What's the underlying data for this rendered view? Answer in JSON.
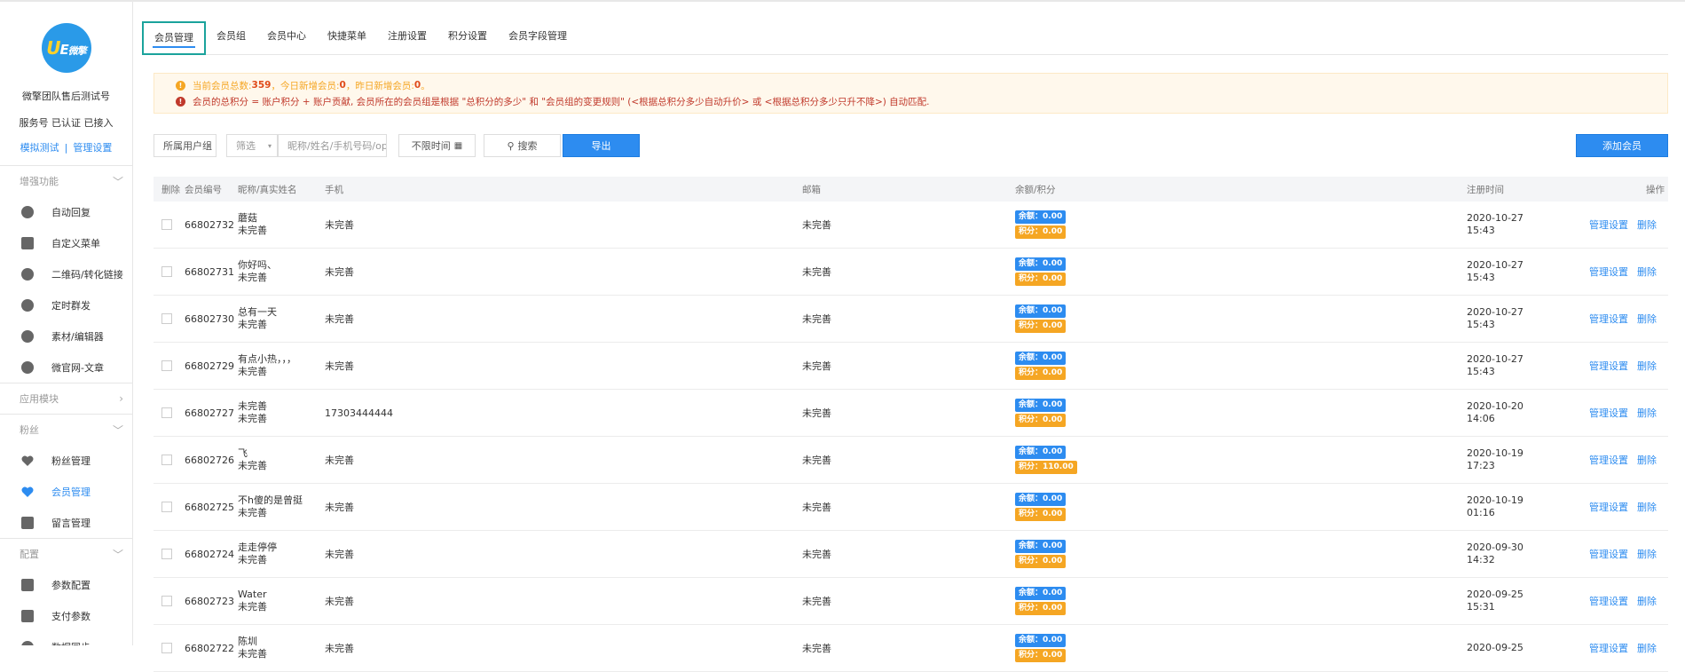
{
  "sidebar": {
    "account_name": "微擎团队售后测试号",
    "account_status": "服务号 已认证 已接入",
    "link_test": "模拟测试",
    "link_sep": "|",
    "link_manage": "管理设置",
    "sections": [
      {
        "title": "增强功能",
        "chevron": "﹀",
        "items": [
          {
            "label": "自动回复",
            "icon": "chat-icon"
          },
          {
            "label": "自定义菜单",
            "icon": "document-icon"
          },
          {
            "label": "二维码/转化链接",
            "icon": "qrcode-icon"
          },
          {
            "label": "定时群发",
            "icon": "clock-icon"
          },
          {
            "label": "素材/编辑器",
            "icon": "pencil-icon"
          },
          {
            "label": "微官网-文章",
            "icon": "home-icon"
          }
        ]
      },
      {
        "title": "应用模块",
        "chevron": "›",
        "items": []
      },
      {
        "title": "粉丝",
        "chevron": "﹀",
        "items": [
          {
            "label": "粉丝管理",
            "icon": "heart-icon"
          },
          {
            "label": "会员管理",
            "icon": "heart-icon",
            "active": true
          },
          {
            "label": "留言管理",
            "icon": "mail-icon"
          }
        ]
      },
      {
        "title": "配置",
        "chevron": "﹀",
        "items": [
          {
            "label": "参数配置",
            "icon": "list-icon"
          },
          {
            "label": "支付参数",
            "icon": "wallet-icon"
          },
          {
            "label": "数据同步",
            "icon": "sync-icon"
          }
        ]
      }
    ]
  },
  "tabs": [
    "会员管理",
    "会员组",
    "会员中心",
    "快捷菜单",
    "注册设置",
    "积分设置",
    "会员字段管理"
  ],
  "notice": {
    "line1_prefix": "当前会员总数:",
    "total": "359",
    "line1_mid": "，今日新增会员:",
    "today": "0",
    "line1_mid2": "，昨日新增会员:",
    "yesterday": "0",
    "line1_end": "。",
    "line2": "会员的总积分 = 账户积分 + 账户贡献, 会员所在的会员组是根据 \"总积分的多少\" 和 \"会员组的变更规则\" (<根据总积分多少自动升价> 或 <根据总积分多少只升不降>) 自动匹配."
  },
  "filters": {
    "group_select": "所属用户组",
    "filter_select": "筛选",
    "search_placeholder": "昵称/姓名/手机号码/openid",
    "time_select": "不限时间",
    "search_button": "搜索",
    "export_button": "导出",
    "add_button": "添加会员"
  },
  "table": {
    "headers": {
      "delete": "删除",
      "id": "会员编号",
      "name": "昵称/真实姓名",
      "phone": "手机",
      "email": "邮箱",
      "balance": "余额/积分",
      "regtime": "注册时间",
      "actions": "操作"
    },
    "balance_label": "余额：",
    "points_label": "积分：",
    "manage_label": "管理设置",
    "delete_label": "删除",
    "rows": [
      {
        "id": "66802732",
        "nick": "蘑菇",
        "real": "未完善",
        "phone": "未完善",
        "email": "未完善",
        "balance": "0.00",
        "points": "0.00",
        "date": "2020-10-27",
        "time": "15:43"
      },
      {
        "id": "66802731",
        "nick": "你好吗、",
        "real": "未完善",
        "phone": "未完善",
        "email": "未完善",
        "balance": "0.00",
        "points": "0.00",
        "date": "2020-10-27",
        "time": "15:43"
      },
      {
        "id": "66802730",
        "nick": "总有一天",
        "real": "未完善",
        "phone": "未完善",
        "email": "未完善",
        "balance": "0.00",
        "points": "0.00",
        "date": "2020-10-27",
        "time": "15:43"
      },
      {
        "id": "66802729",
        "nick": "有点小热，，，",
        "real": "未完善",
        "phone": "未完善",
        "email": "未完善",
        "balance": "0.00",
        "points": "0.00",
        "date": "2020-10-27",
        "time": "15:43"
      },
      {
        "id": "66802727",
        "nick": "未完善",
        "real": "未完善",
        "phone": "17303444444",
        "email": "未完善",
        "balance": "0.00",
        "points": "0.00",
        "date": "2020-10-20",
        "time": "14:06"
      },
      {
        "id": "66802726",
        "nick": "飞",
        "real": "未完善",
        "phone": "未完善",
        "email": "未完善",
        "balance": "0.00",
        "points": "110.00",
        "date": "2020-10-19",
        "time": "17:23"
      },
      {
        "id": "66802725",
        "nick": "不h傻的是曾挺",
        "real": "未完善",
        "phone": "未完善",
        "email": "未完善",
        "balance": "0.00",
        "points": "0.00",
        "date": "2020-10-19",
        "time": "01:16"
      },
      {
        "id": "66802724",
        "nick": "走走停停",
        "real": "未完善",
        "phone": "未完善",
        "email": "未完善",
        "balance": "0.00",
        "points": "0.00",
        "date": "2020-09-30",
        "time": "14:32"
      },
      {
        "id": "66802723",
        "nick": "Water",
        "real": "未完善",
        "phone": "未完善",
        "email": "未完善",
        "balance": "0.00",
        "points": "0.00",
        "date": "2020-09-25",
        "time": "15:31"
      },
      {
        "id": "66802722",
        "nick": "陈圳",
        "real": "未完善",
        "phone": "未完善",
        "email": "未完善",
        "balance": "0.00",
        "points": "0.00",
        "date": "2020-09-25",
        "time": ""
      }
    ]
  },
  "colors": {
    "accent": "#2d8cf0",
    "points": "#f5a623",
    "active_tab_border": "#1ba39c",
    "warning": "#c0392b"
  }
}
